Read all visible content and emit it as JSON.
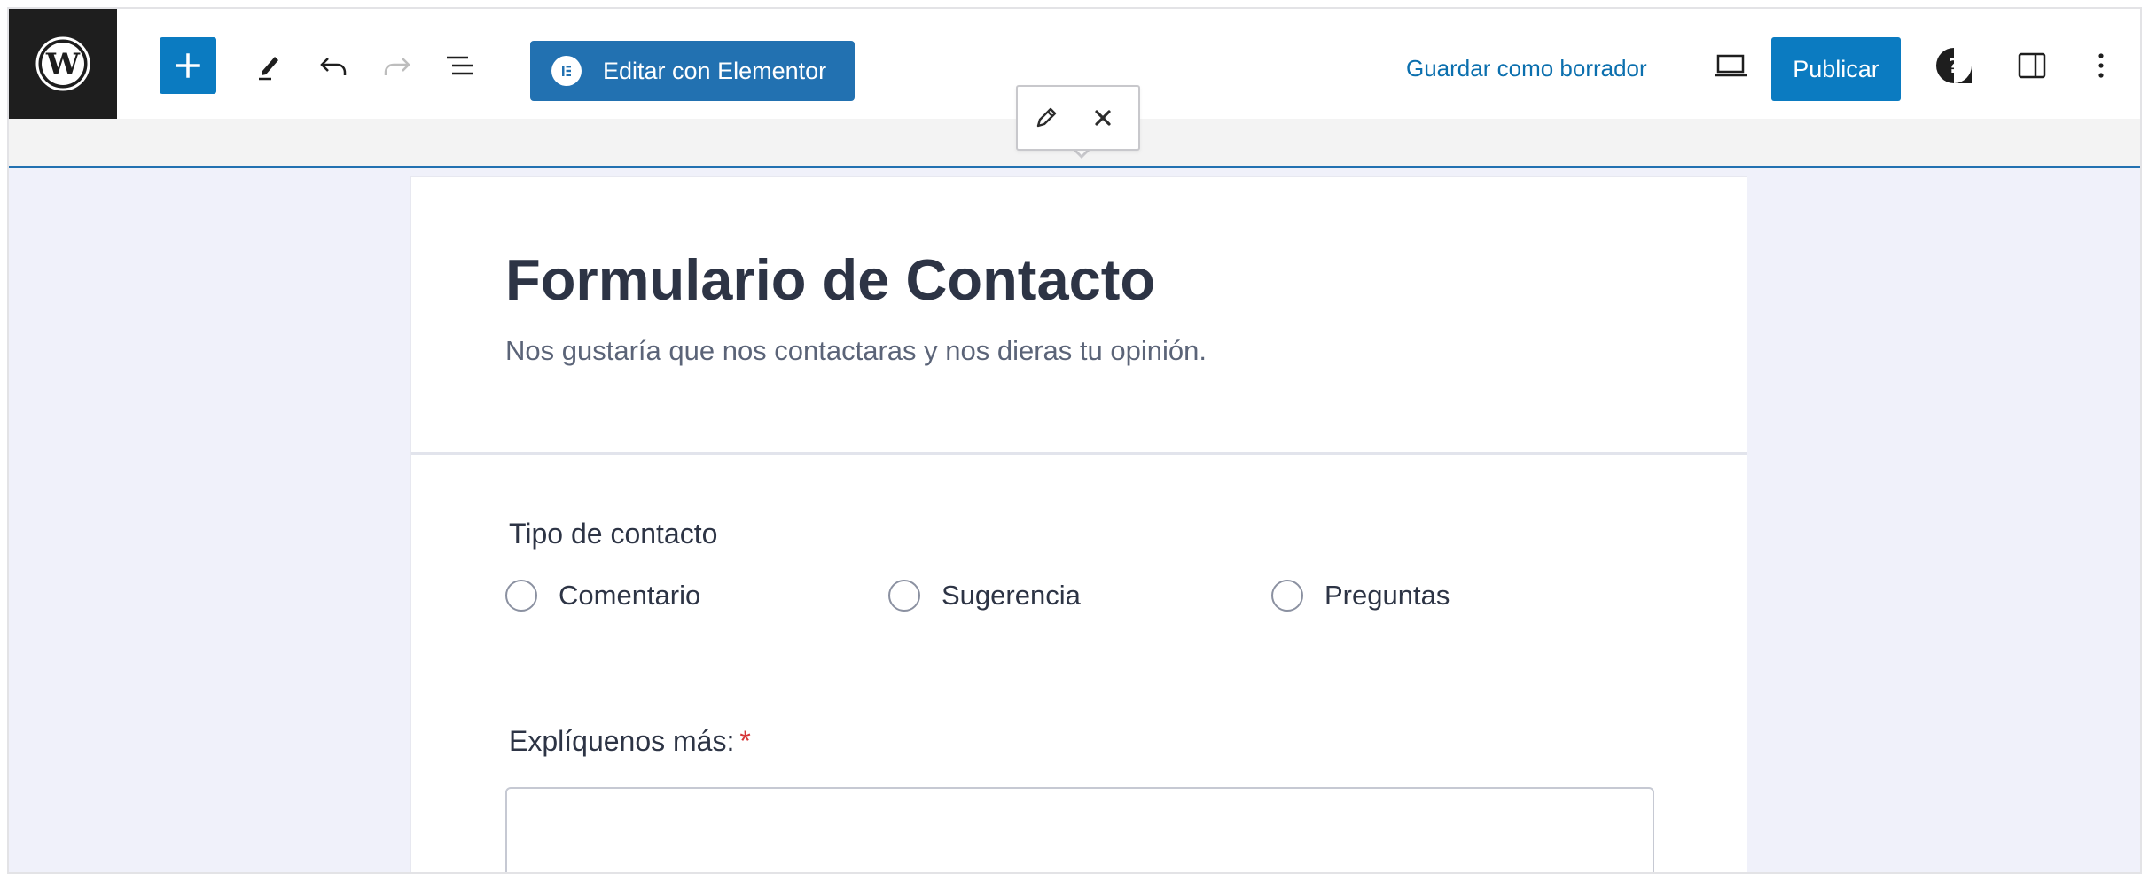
{
  "toolbar": {
    "logo": "wordpress-icon",
    "add_icon": "plus-icon",
    "tools_icon": "pencil-icon",
    "undo_icon": "undo-icon",
    "redo_icon": "redo-icon",
    "list_view_icon": "list-view-icon",
    "elementor_label": "Editar con Elementor",
    "save_draft_label": "Guardar como borrador",
    "preview_icon": "laptop-icon",
    "publish_label": "Publicar",
    "help_icon": "help-icon",
    "settings_icon": "sidebar-icon",
    "options_icon": "more-vertical-icon",
    "accent_color": "#0b7bc1"
  },
  "popover": {
    "edit_icon": "pencil-icon",
    "close_icon": "close-icon"
  },
  "form": {
    "title": "Formulario de Contacto",
    "subtitle": "Nos gustaría que nos contactaras y nos dieras tu opinión.",
    "contact_type_label": "Tipo de contacto",
    "options": [
      "Comentario",
      "Sugerencia",
      "Preguntas"
    ],
    "more_label": "Explíquenos más:",
    "required_mark": "*",
    "more_value": ""
  }
}
